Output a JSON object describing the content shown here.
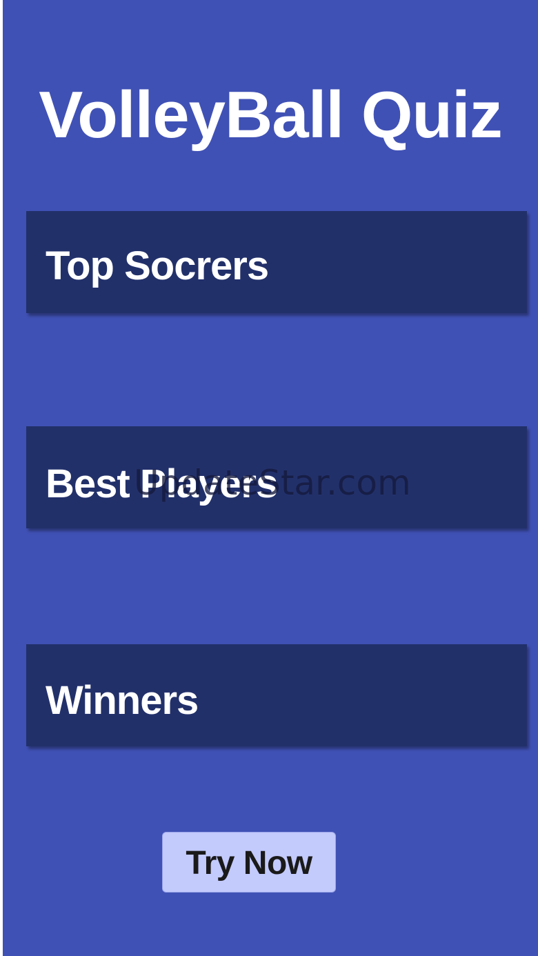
{
  "app": {
    "title": "VolleyBall Quiz"
  },
  "menu": {
    "items": [
      {
        "label": "Top Socrers"
      },
      {
        "label": "Best Players"
      },
      {
        "label": "Winners"
      }
    ]
  },
  "actions": {
    "try_label": "Try Now"
  },
  "watermark": {
    "text": "UpdateStar.com"
  },
  "colors": {
    "background": "#4051b5",
    "card": "#22306a",
    "button": "#c3cafc",
    "title_text": "#ffffff"
  }
}
